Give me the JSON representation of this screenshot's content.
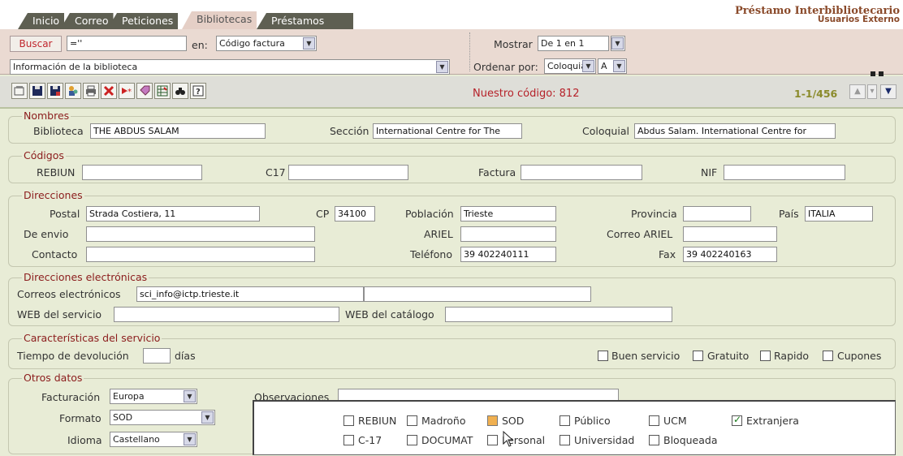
{
  "tabs": [
    {
      "label": "Inicio"
    },
    {
      "label": "Correo"
    },
    {
      "label": "Peticiones"
    },
    {
      "label": "Bibliotecas"
    },
    {
      "label": "Préstamos"
    }
  ],
  "app": {
    "title": "Préstamo Interbibliotecario",
    "subtitle": "Usuarios Externo"
  },
  "search": {
    "button": "Buscar",
    "query": "=''",
    "en_label": "en:",
    "field": "Código factura",
    "info": "Información de la biblioteca",
    "mostrar_label": "Mostrar",
    "mostrar_value": "De 1 en 1",
    "ordenar_label": "Ordenar por:",
    "ordenar_value": "Coloquial",
    "ordenar_dir": "A"
  },
  "toolbar": {
    "our_code": "Nuestro código: 812",
    "record_pos": "1-1/456"
  },
  "nombres": {
    "legend": "Nombres",
    "biblioteca_label": "Biblioteca",
    "biblioteca": "THE ABDUS SALAM",
    "seccion_label": "Sección",
    "seccion": "International Centre for The",
    "coloquial_label": "Coloquial",
    "coloquial": "Abdus Salam. International Centre for"
  },
  "codigos": {
    "legend": "Códigos",
    "rebiun_label": "REBIUN",
    "rebiun": "",
    "c17_label": "C17",
    "c17": "",
    "factura_label": "Factura",
    "factura": "",
    "nif_label": "NIF",
    "nif": ""
  },
  "direcciones": {
    "legend": "Direcciones",
    "postal_label": "Postal",
    "postal": "Strada Costiera, 11",
    "cp_label": "CP",
    "cp": "34100",
    "poblacion_label": "Población",
    "poblacion": "Trieste",
    "provincia_label": "Provincia",
    "provincia": "",
    "pais_label": "País",
    "pais": "ITALIA",
    "envio_label": "De envio",
    "envio": "",
    "ariel_label": "ARIEL",
    "ariel": "",
    "correo_ariel_label": "Correo ARIEL",
    "correo_ariel": "",
    "contacto_label": "Contacto",
    "contacto": "",
    "telefono_label": "Teléfono",
    "telefono": "39 402240111",
    "fax_label": "Fax",
    "fax": "39 402240163"
  },
  "electronicas": {
    "legend": "Direcciones electrónicas",
    "correos_label": "Correos electrónicos",
    "correo1": "sci_info@ictp.trieste.it",
    "correo2": "",
    "web_label": "WEB del servicio",
    "web": "",
    "catalogo_label": "WEB del catálogo",
    "catalogo": ""
  },
  "servicio": {
    "legend": "Características del servicio",
    "devolucion_label": "Tiempo de devolución",
    "devolucion": "",
    "dias": "días",
    "checks": [
      {
        "label": "Buen servicio",
        "checked": false
      },
      {
        "label": "Gratuito",
        "checked": false
      },
      {
        "label": "Rapido",
        "checked": false
      },
      {
        "label": "Cupones",
        "checked": false
      }
    ]
  },
  "otros": {
    "legend": "Otros datos",
    "facturacion_label": "Facturación",
    "facturacion": "Europa",
    "formato_label": "Formato",
    "formato": "SOD",
    "idioma_label": "Idioma",
    "idioma": "Castellano",
    "observaciones_label": "Observaciones",
    "observaciones": "",
    "row1": [
      {
        "label": "REBIUN",
        "checked": false
      },
      {
        "label": "Madroño",
        "checked": false
      },
      {
        "label": "SOD",
        "checked": false
      },
      {
        "label": "Público",
        "checked": false
      },
      {
        "label": "UCM",
        "checked": false
      },
      {
        "label": "Extranjera",
        "checked": true
      }
    ],
    "row2": [
      {
        "label": "C-17",
        "checked": false
      },
      {
        "label": "DOCUMAT",
        "checked": false
      },
      {
        "label": "Personal",
        "checked": false
      },
      {
        "label": "Universidad",
        "checked": false
      },
      {
        "label": "Bloqueada",
        "checked": false
      }
    ]
  },
  "colors": {
    "tab_bg": "#5e5f52",
    "active_tab_bg": "#e5cfc6",
    "legend": "#8b1c1c",
    "panel": "#e8ecd6",
    "accent_red": "#b6222a"
  }
}
